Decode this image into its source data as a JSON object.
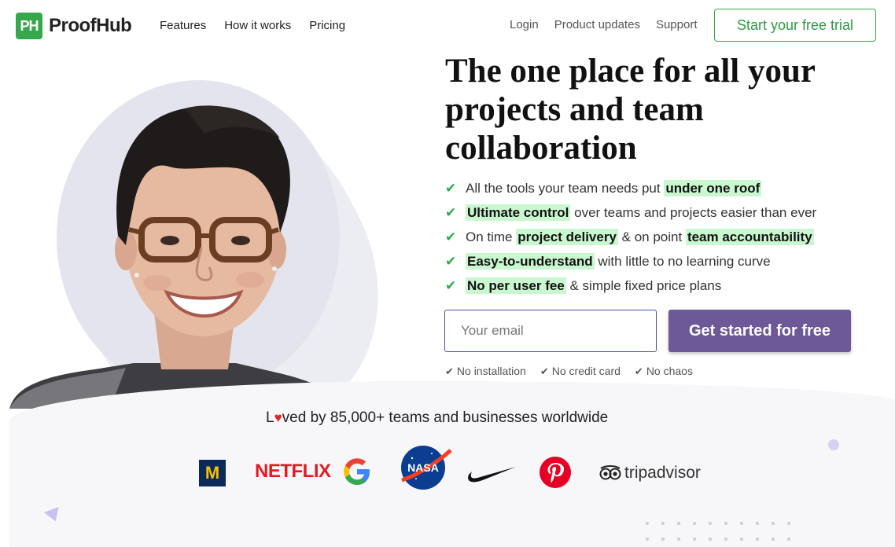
{
  "brand": {
    "mark": "PH",
    "name": "ProofHub",
    "primary_color": "#36a84b",
    "accent_color": "#6d5898"
  },
  "nav": {
    "left": [
      "Features",
      "How it works",
      "Pricing"
    ],
    "right": [
      "Login",
      "Product updates",
      "Support"
    ],
    "trial_button": "Start your free trial"
  },
  "hero": {
    "headline": "The one place for all your projects and team collaboration",
    "features": [
      {
        "parts": [
          {
            "t": "All the tools your team needs put ",
            "h": false
          },
          {
            "t": "under one roof",
            "h": true
          }
        ]
      },
      {
        "parts": [
          {
            "t": "Ultimate control",
            "h": true
          },
          {
            "t": " over teams and projects easier than ever",
            "h": false
          }
        ]
      },
      {
        "parts": [
          {
            "t": "On time ",
            "h": false
          },
          {
            "t": "project delivery",
            "h": true
          },
          {
            "t": " & on point ",
            "h": false
          },
          {
            "t": "team accountability",
            "h": true
          }
        ]
      },
      {
        "parts": [
          {
            "t": "Easy-to-understand",
            "h": true
          },
          {
            "t": " with little to no learning curve",
            "h": false
          }
        ]
      },
      {
        "parts": [
          {
            "t": "No per user fee",
            "h": true
          },
          {
            "t": " & simple fixed price plans",
            "h": false
          }
        ]
      }
    ],
    "email_placeholder": "Your email",
    "cta": "Get started for free",
    "notes": [
      "No installation",
      "No credit card",
      "No chaos"
    ]
  },
  "social_proof": {
    "loved_prefix": "L",
    "loved_suffix": "ved by 85,000+ teams and businesses worldwide",
    "logos": {
      "michigan": "M",
      "netflix": "NETFLIX",
      "nasa": "NASA",
      "tripadvisor": "tripadvisor"
    }
  }
}
